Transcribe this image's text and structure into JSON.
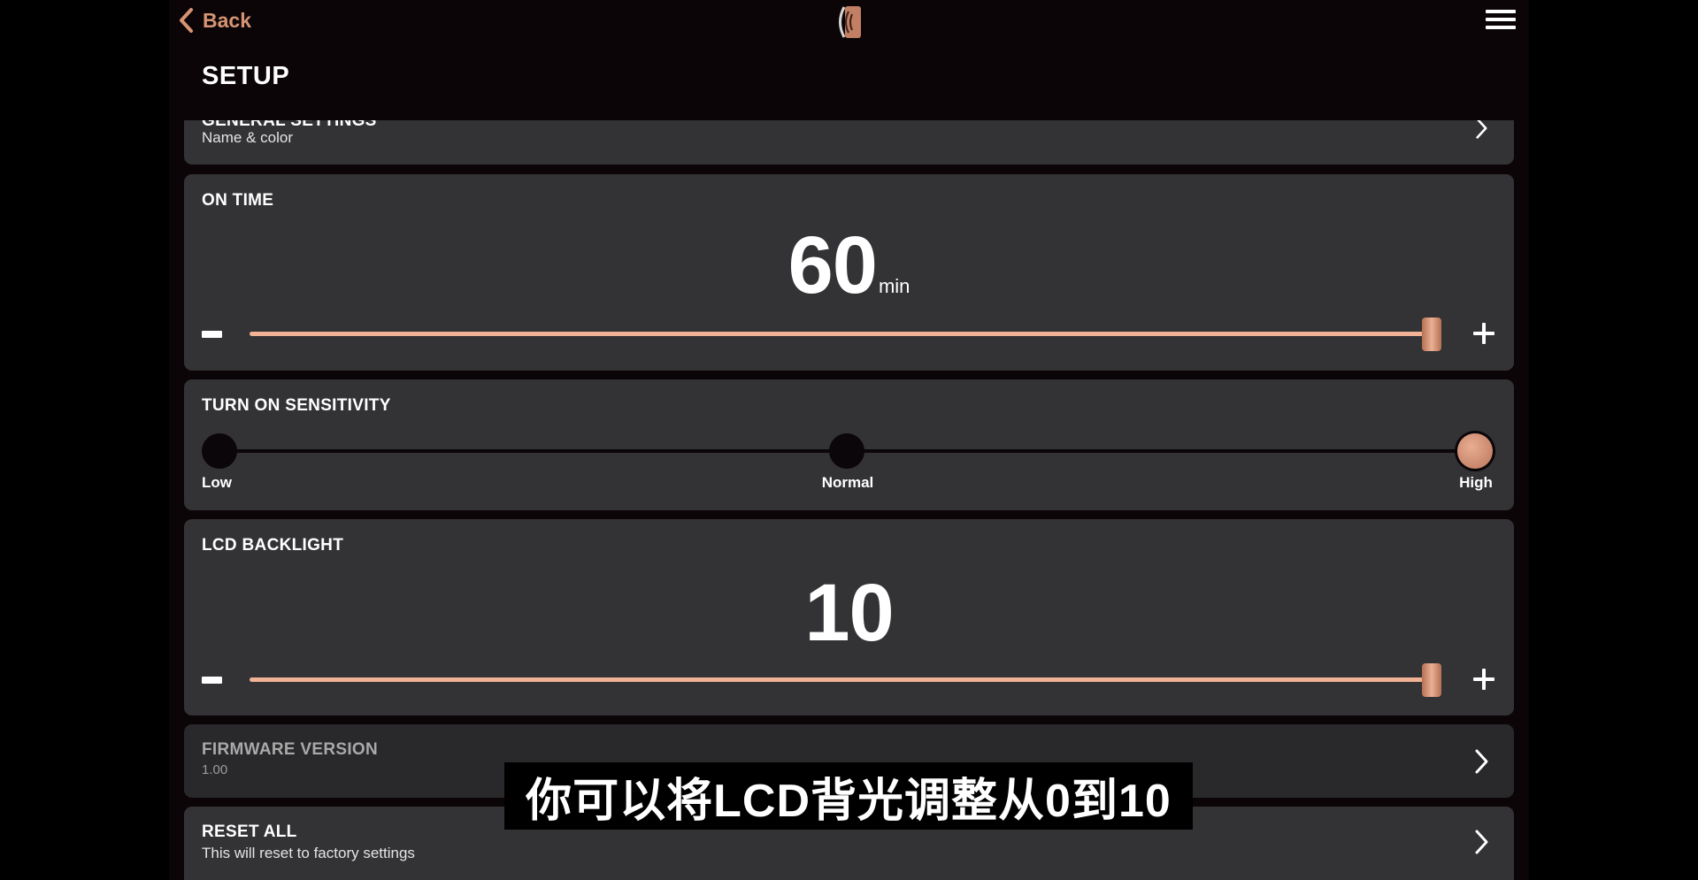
{
  "nav": {
    "back_label": "Back",
    "title": "SETUP"
  },
  "general": {
    "title": "GENERAL SETTINGS",
    "subtitle": "Name & color"
  },
  "on_time": {
    "title": "ON TIME",
    "value": "60",
    "unit": "min",
    "slider_level": 1.0
  },
  "sensitivity": {
    "title": "TURN ON SENSITIVITY",
    "options": [
      "Low",
      "Normal",
      "High"
    ],
    "selected": "High"
  },
  "backlight": {
    "title": "LCD BACKLIGHT",
    "value": "10",
    "slider_level": 1.0
  },
  "firmware": {
    "title": "FIRMWARE VERSION",
    "version": "1.00"
  },
  "reset": {
    "title": "RESET ALL",
    "subtitle": "This will reset to factory settings"
  },
  "caption": "你可以将LCD背光调整从0到10",
  "colors": {
    "accent": "#d69473",
    "card": "#333235",
    "background": "#0c0508"
  }
}
